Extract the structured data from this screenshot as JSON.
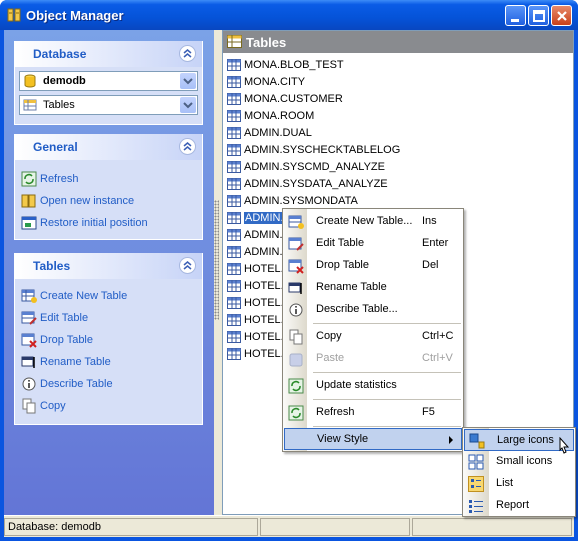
{
  "window": {
    "title": "Object Manager"
  },
  "left_panel": {
    "database_group": {
      "title": "Database",
      "database_combo": "demodb",
      "object_combo": "Tables"
    },
    "general_group": {
      "title": "General",
      "items": [
        "Refresh",
        "Open new instance",
        "Restore initial position"
      ]
    },
    "tables_group": {
      "title": "Tables",
      "items": [
        "Create New Table",
        "Edit Table",
        "Drop Table",
        "Rename Table",
        "Describe Table",
        "Copy"
      ]
    }
  },
  "right_panel": {
    "header": "Tables",
    "items": [
      "MONA.BLOB_TEST",
      "MONA.CITY",
      "MONA.CUSTOMER",
      "MONA.ROOM",
      "ADMIN.DUAL",
      "ADMIN.SYSCHECKTABLELOG",
      "ADMIN.SYSCMD_ANALYZE",
      "ADMIN.SYSDATA_ANALYZE",
      "ADMIN.SYSMONDATA",
      "ADMIN.S",
      "ADMIN.S",
      "ADMIN.S",
      "HOTEL.",
      "HOTEL.",
      "HOTEL.",
      "HOTEL.",
      "HOTEL.",
      "HOTEL."
    ],
    "selected_index": 9
  },
  "context_menu": {
    "create": {
      "label": "Create New Table...",
      "key": "Ins"
    },
    "edit": {
      "label": "Edit Table",
      "key": "Enter"
    },
    "drop": {
      "label": "Drop Table",
      "key": "Del"
    },
    "rename": {
      "label": "Rename Table",
      "key": ""
    },
    "describe": {
      "label": "Describe Table...",
      "key": ""
    },
    "copy": {
      "label": "Copy",
      "key": "Ctrl+C"
    },
    "paste": {
      "label": "Paste",
      "key": "Ctrl+V"
    },
    "update": {
      "label": "Update statistics",
      "key": ""
    },
    "refresh": {
      "label": "Refresh",
      "key": "F5"
    },
    "view_style": {
      "label": "View Style"
    }
  },
  "view_style_submenu": {
    "large": "Large icons",
    "small": "Small icons",
    "list": "List",
    "report": "Report"
  },
  "statusbar": {
    "text": "Database: demodb"
  },
  "colors": {
    "selection": "#316ac5",
    "link": "#215dc6",
    "menu_highlight": "#c1d2ee"
  }
}
